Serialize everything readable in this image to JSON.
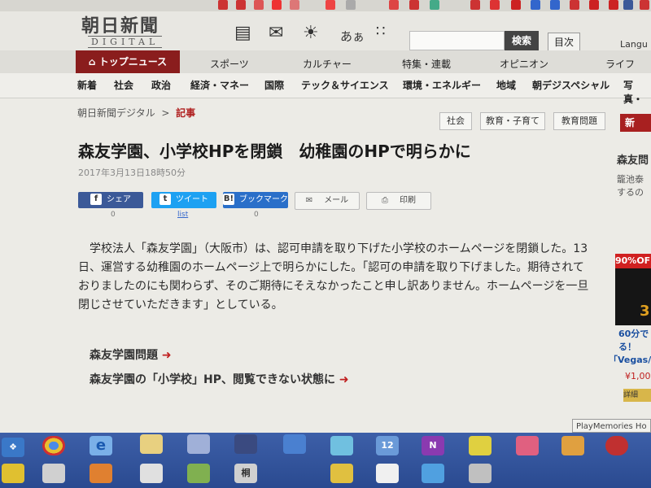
{
  "header": {
    "logo_main": "朝日新聞",
    "logo_sub": "DIGITAL",
    "search_button": "検索",
    "toc_button": "目次",
    "language": "Langu",
    "icons": [
      "newspaper-icon",
      "megaphone-icon",
      "weather-icon",
      "font-size-icon",
      "grid-menu-icon"
    ],
    "font_icon_text": "あぁ"
  },
  "nav_primary": [
    "トップニュース",
    "スポーツ",
    "カルチャー",
    "特集・連載",
    "オピニオン",
    "ライフ"
  ],
  "nav_secondary": [
    "新着",
    "社会",
    "政治",
    "経済・マネー",
    "国際",
    "テック＆サイエンス",
    "環境・エネルギー",
    "地域",
    "朝デジスペシャル",
    "写真・"
  ],
  "breadcrumb": {
    "home": "朝日新聞デジタル",
    "separator": ">",
    "current": "記事"
  },
  "tags": [
    "社会",
    "教育・子育て",
    "教育問題"
  ],
  "article": {
    "title": "森友学園、小学校HPを閉鎖　幼稚園のHPで明らかに",
    "date": "2017年3月13日18時50分",
    "body": "　学校法人「森友学園」（大阪市）は、認可申請を取り下げた小学校のホームページを閉鎖した。13日、運営する幼稚園のホームページ上で明らかにした。「認可の申請を取り下げました。期待されておりましたのにも関わらず、そのご期待にそえなかったこと申し訳ありません。ホームページを一旦閉じさせていただきます」としている。"
  },
  "share": {
    "facebook": {
      "label": "シェア",
      "count": "0"
    },
    "twitter": {
      "label": "ツイート",
      "count": "list"
    },
    "hatena": {
      "label": "ブックマーク",
      "count": "0"
    },
    "mail": {
      "label": "メール"
    },
    "print": {
      "label": "印刷"
    }
  },
  "related_links": [
    "森友学園問題",
    "森友学園の「小学校」HP、閲覧できない状態に"
  ],
  "sidebar": {
    "red_label": "新",
    "title": "森友問",
    "text_lines": [
      "籠池泰",
      "するの"
    ],
    "ad_badge": "90%OF",
    "ad_digit": "3",
    "ad_caption_1": "60分で",
    "ad_caption_2": "る！",
    "ad_caption_3": "「Vegas/M",
    "ad_price": "¥1,00",
    "ad_button": "詳細"
  },
  "tooltip": "PlayMemories Ho",
  "taskbar": {
    "icons": [
      "windows-start-icon",
      "chrome-icon",
      "internet-explorer-icon",
      "note-icon",
      "people-icon",
      "pen-icon",
      "cloud-icon",
      "maps-icon",
      "calendar-icon",
      "onenote-icon",
      "sticky-notes-icon",
      "paint-icon",
      "photos-icon",
      "media-icon",
      "weather-icon",
      "folder-icon",
      "game-icon",
      "puzzle-icon",
      "kanji-icon",
      "notes-icon",
      "skype-icon",
      "music-icon",
      "settings-icon",
      "store-icon"
    ],
    "calendar_day": "12",
    "onenote_letter": "N"
  },
  "colors": {
    "brand_red": "#8a1d1d",
    "facebook": "#3b5998",
    "twitter": "#1da1f2",
    "hatena": "#2a6fc9",
    "taskbar": "#2a4a90"
  }
}
